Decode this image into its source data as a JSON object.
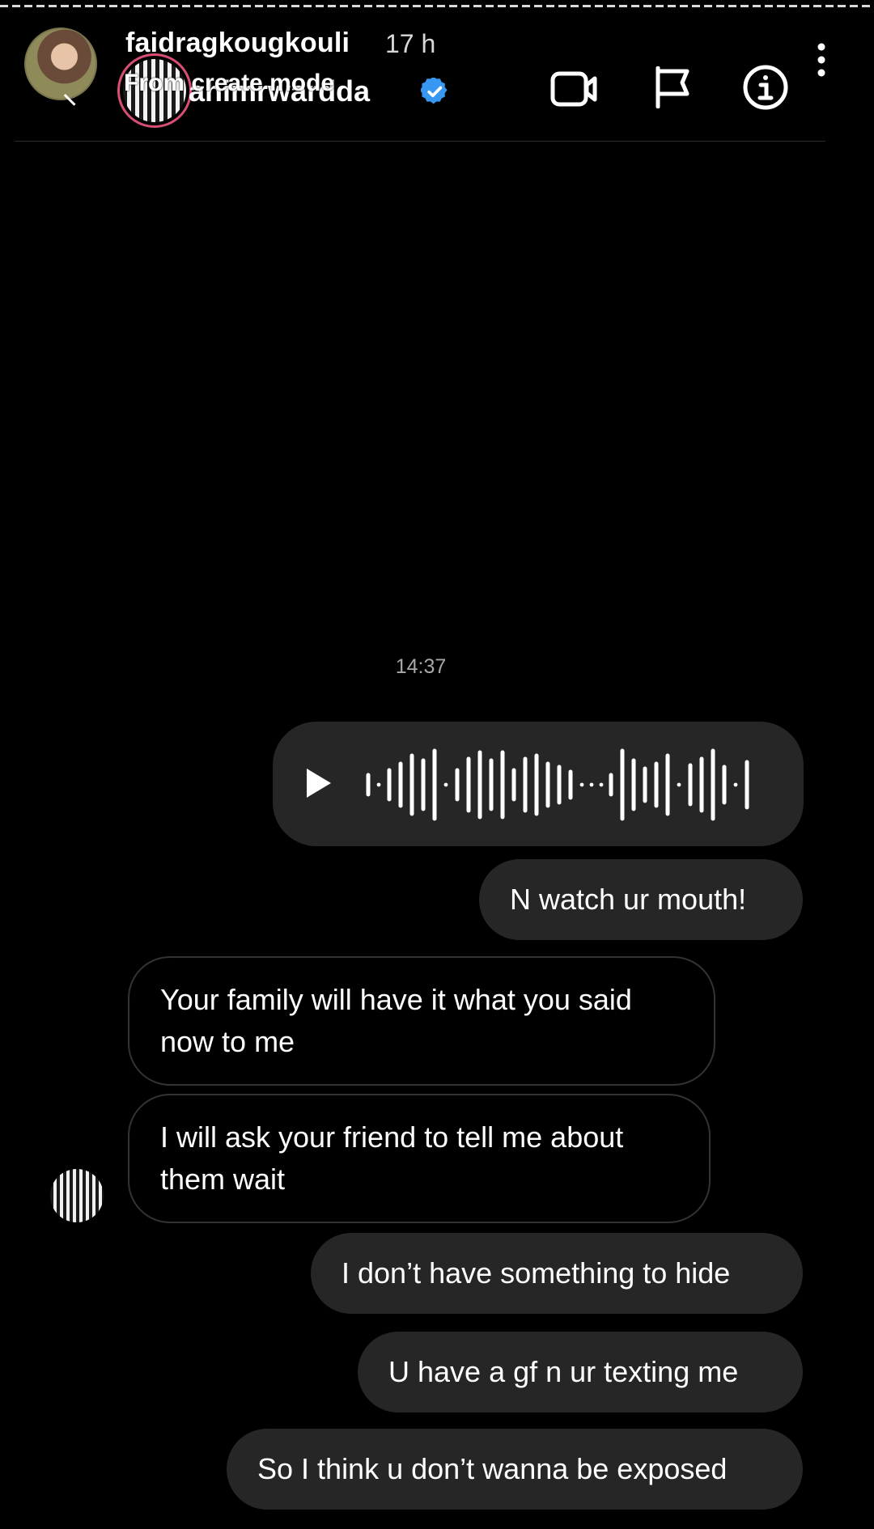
{
  "header": {
    "username": "faidragkougkouli",
    "time_ago": "17 h",
    "chat_name": "ahimrwardda",
    "overlay_label": "From create mode"
  },
  "conversation": {
    "timestamp": "14:37",
    "messages": [
      {
        "side": "outgoing",
        "type": "voice",
        "text": "Play voice message"
      },
      {
        "side": "outgoing",
        "type": "text",
        "text": "N watch ur mouth!"
      },
      {
        "side": "incoming",
        "type": "text",
        "text": "Your family will have it what you said now to me"
      },
      {
        "side": "incoming",
        "type": "text",
        "text": "I will ask your friend to tell me about them wait"
      },
      {
        "side": "outgoing",
        "type": "text",
        "text": "I don’t have something to hide"
      },
      {
        "side": "outgoing",
        "type": "text",
        "text": "U have a gf n ur texting me"
      },
      {
        "side": "outgoing",
        "type": "text",
        "text": "So I think u don’t wanna be exposed"
      }
    ]
  },
  "icons": {
    "video": "video-call-icon",
    "flag": "report-flag-icon",
    "info": "info-icon",
    "more": "more-options-icon",
    "verified": "verified-badge-icon"
  },
  "colors": {
    "background": "#000000",
    "outgoing_bubble": "#262626",
    "incoming_border": "#333333",
    "verified": "#3897f0",
    "story_ring": "#d94f74"
  }
}
